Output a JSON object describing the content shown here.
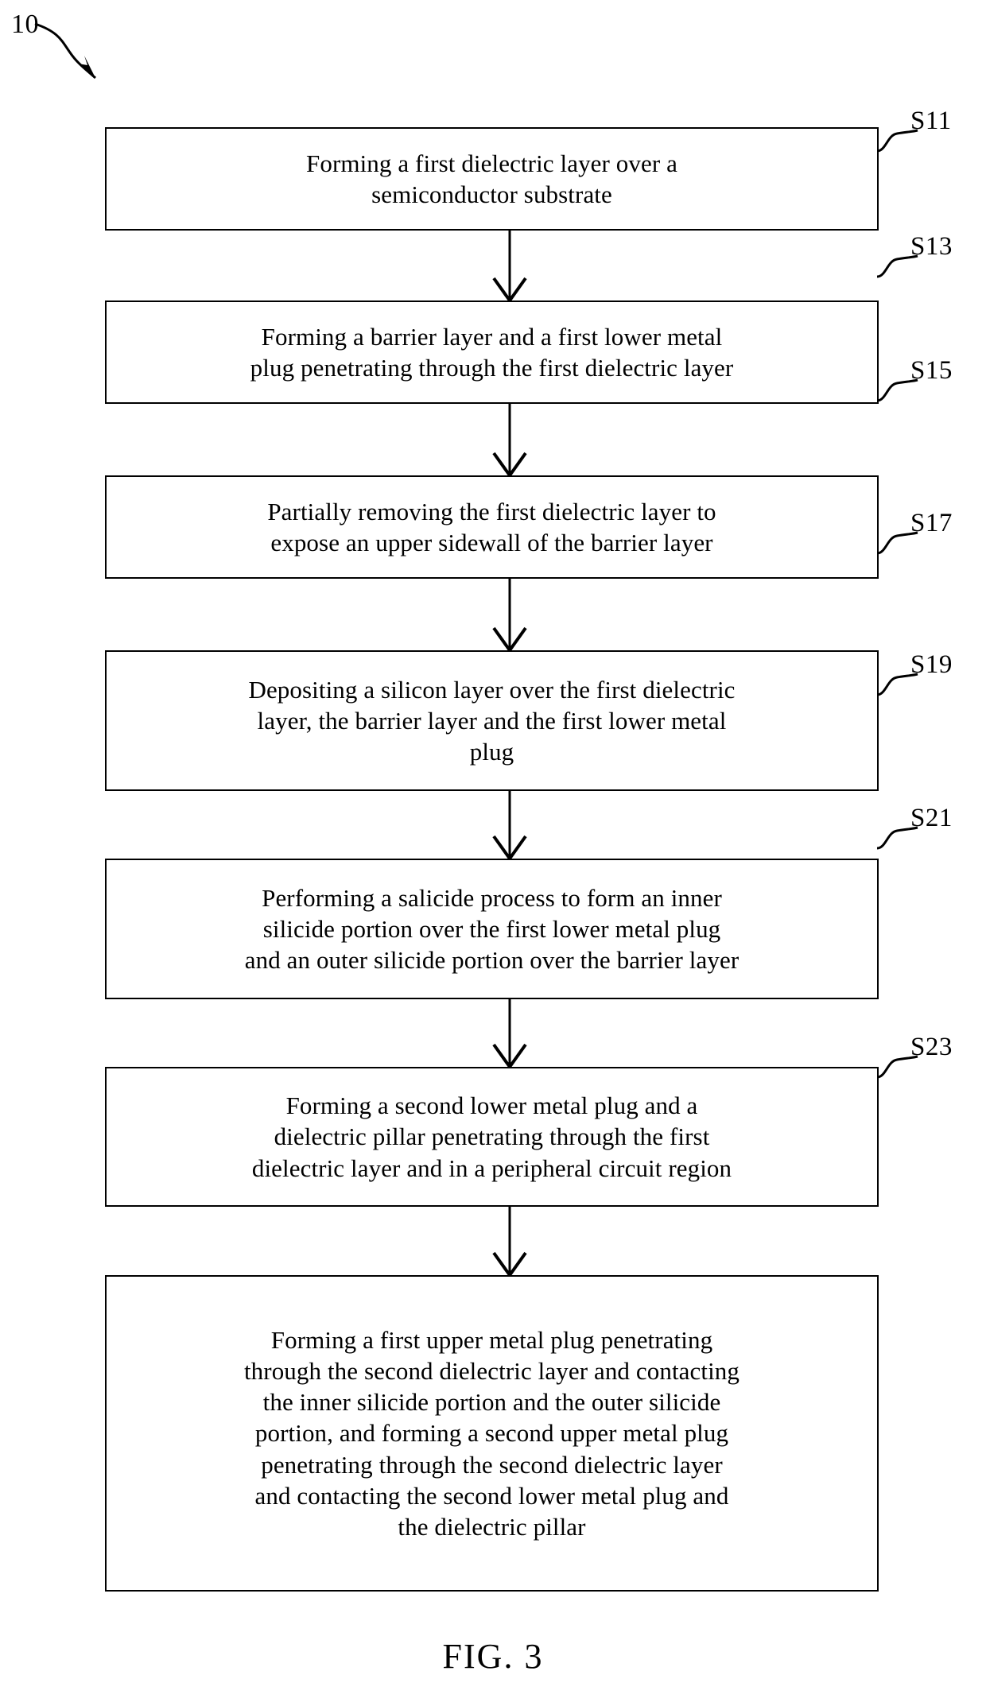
{
  "figure": {
    "caption": "FIG. 3",
    "reference_numeral": "10"
  },
  "flowchart": {
    "steps": [
      {
        "id": "S11",
        "label": "S11",
        "text": "Forming a first dielectric layer over a\nsemiconductor substrate"
      },
      {
        "id": "S13",
        "label": "S13",
        "text": "Forming a barrier layer and a first lower metal\nplug penetrating through the first dielectric layer"
      },
      {
        "id": "S15",
        "label": "S15",
        "text": "Partially removing the first dielectric layer to\nexpose an upper sidewall of the barrier layer"
      },
      {
        "id": "S17",
        "label": "S17",
        "text": "Depositing a silicon layer over the first dielectric\nlayer, the barrier layer and the first lower metal\nplug"
      },
      {
        "id": "S19",
        "label": "S19",
        "text": "Performing a salicide process to form an inner\nsilicide portion over the first lower metal plug\nand an outer silicide portion over the barrier layer"
      },
      {
        "id": "S21",
        "label": "S21",
        "text": "Forming a second lower metal plug and a\ndielectric pillar penetrating through the first\ndielectric layer and in a peripheral circuit region"
      },
      {
        "id": "S23",
        "label": "S23",
        "text": "Forming a first upper metal plug penetrating\nthrough the second dielectric layer and contacting\nthe inner silicide portion and the outer silicide\nportion, and forming a second upper metal plug\npenetrating through the second dielectric layer\nand contacting the second lower metal plug and\nthe dielectric pillar"
      }
    ]
  },
  "style": {
    "line_color": "#000000",
    "background_color": "#ffffff"
  }
}
